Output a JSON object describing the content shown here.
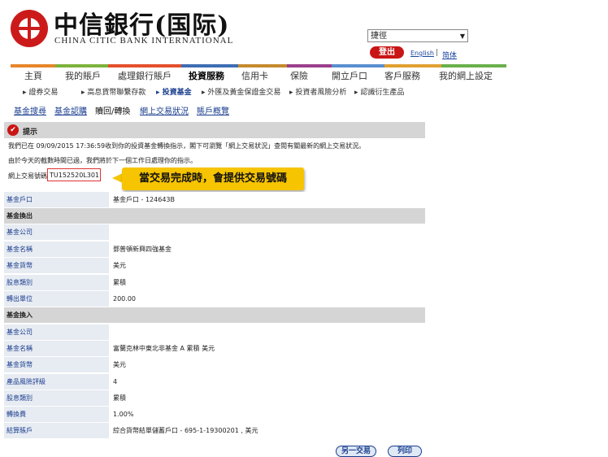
{
  "header": {
    "logo_cn": "中信銀行(国际)",
    "logo_en": "CHINA CITIC BANK INTERNATIONAL",
    "lang_value": "捷徑",
    "logout": "登出",
    "english": "English",
    "sep": "|",
    "simplified": "简体"
  },
  "colors": {
    "brand_red": "#cc1a1a",
    "nav_bars": [
      "#e7862a",
      "#7db23c",
      "#e3502a",
      "#3e6db3",
      "#c48b2c",
      "#9b3e8c",
      "#5a8fd0",
      "#e0a030",
      "#6ab04c"
    ]
  },
  "nav": [
    "主頁",
    "我的賬戶",
    "處理銀行賬戶",
    "投資服務",
    "信用卡",
    "保險",
    "開立戶口",
    "客戶服務",
    "我的網上設定"
  ],
  "subnav": [
    "證券交易",
    "高息貨幣聯繫存款",
    "投資基金",
    "外匯及黃金保證金交易",
    "投資者風險分析",
    "認識衍生產品"
  ],
  "tabs": [
    "基金搜尋",
    "基金認購",
    "贖回/轉換",
    "網上交易狀況",
    "賬戶概覽"
  ],
  "tip": {
    "title": "提示",
    "line1": "我們已在 09/09/2015 17:36:59收到你的投資基金轉換指示，閣下可瀏覽「網上交易狀況」查閱有關最新的網上交易狀況。",
    "line2": "由於今天的截數時間已過，我們將於下一個工作日處理你的指示。",
    "ref_label": "網上交易號碼",
    "ref_value": "TU152520L301",
    "callout": "當交易完成時，會提供交易號碼"
  },
  "table": {
    "account_label": "基金戶口",
    "account_value": "基金戶口 - 124643B",
    "out_header": "基金換出",
    "out": [
      {
        "label": "基金公司",
        "value": ""
      },
      {
        "label": "基金名稱",
        "value": "鄧普頓新興四強基金"
      },
      {
        "label": "基金貨幣",
        "value": "美元"
      },
      {
        "label": "股息類別",
        "value": "累積"
      },
      {
        "label": "轉出單位",
        "value": "200.00"
      }
    ],
    "in_header": "基金換入",
    "in": [
      {
        "label": "基金公司",
        "value": ""
      },
      {
        "label": "基金名稱",
        "value": "富蘭克林中東北非基金 A 累積 美元"
      },
      {
        "label": "基金貨幣",
        "value": "美元"
      },
      {
        "label": "產品風險評級",
        "value": "4"
      },
      {
        "label": "股息類別",
        "value": "累積"
      },
      {
        "label": "轉換費",
        "value": "1.00%"
      },
      {
        "label": "結算賬戶",
        "value": "綜合貨幣結單儲蓄戶口 - 695-1-19300201 , 美元"
      }
    ]
  },
  "buttons": {
    "another": "另一交易",
    "print": "列印"
  }
}
